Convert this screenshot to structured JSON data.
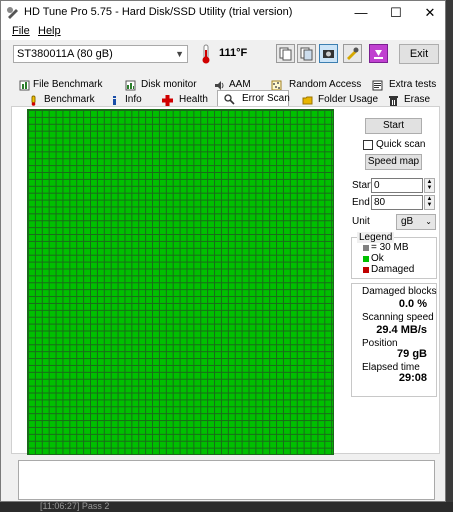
{
  "window": {
    "title": "HD Tune Pro 5.75 - Hard Disk/SSD Utility (trial version)",
    "minimize_glyph": "—",
    "maximize_glyph": "☐",
    "close_glyph": "✕"
  },
  "menu": {
    "file": "File",
    "help": "Help"
  },
  "toolbar": {
    "drive": "ST380011A (80 gB)",
    "temperature": "111°F",
    "exit_label": "Exit",
    "icons": [
      "copy-text-icon",
      "copy-info-icon",
      "screenshot-icon",
      "options-icon",
      "save-icon"
    ]
  },
  "tabs_row1": [
    {
      "label": "File Benchmark",
      "icon": "file-benchmark-icon"
    },
    {
      "label": "Disk monitor",
      "icon": "disk-monitor-icon"
    },
    {
      "label": "AAM",
      "icon": "speaker-icon"
    },
    {
      "label": "Random Access",
      "icon": "random-access-icon"
    },
    {
      "label": "Extra tests",
      "icon": "extra-tests-icon"
    }
  ],
  "tabs_row2": [
    {
      "label": "Benchmark",
      "icon": "benchmark-icon"
    },
    {
      "label": "Info",
      "icon": "info-icon"
    },
    {
      "label": "Health",
      "icon": "health-cross-icon"
    },
    {
      "label": "Error Scan",
      "icon": "magnifier-icon",
      "active": true
    },
    {
      "label": "Folder Usage",
      "icon": "folder-icon"
    },
    {
      "label": "Erase",
      "icon": "erase-icon"
    }
  ],
  "controls": {
    "start_button": "Start",
    "quick_scan_label": "Quick scan",
    "quick_scan_checked": false,
    "speed_map_button": "Speed map",
    "start_label": "Start",
    "start_value": "0",
    "end_label": "End",
    "end_value": "80",
    "unit_label": "Unit",
    "unit_value": "gB"
  },
  "legend": {
    "title": "Legend",
    "block_size": "= 30 MB",
    "ok": "Ok",
    "damaged": "Damaged",
    "colors": {
      "block": "#808080",
      "ok": "#00c000",
      "damaged": "#c00000"
    }
  },
  "stats": {
    "damaged_blocks_label": "Damaged blocks",
    "damaged_blocks_value": "0.0 %",
    "scanning_speed_label": "Scanning speed",
    "scanning_speed_value": "29.4 MB/s",
    "position_label": "Position",
    "position_value": "79 gB",
    "elapsed_label": "Elapsed time",
    "elapsed_value": "29:08"
  },
  "scan_grid": {
    "status": "all blocks ok",
    "ok_fraction": 1.0,
    "color": "#00c000"
  },
  "taskbar": {
    "text": "[11:06:27]  Pass 2"
  }
}
